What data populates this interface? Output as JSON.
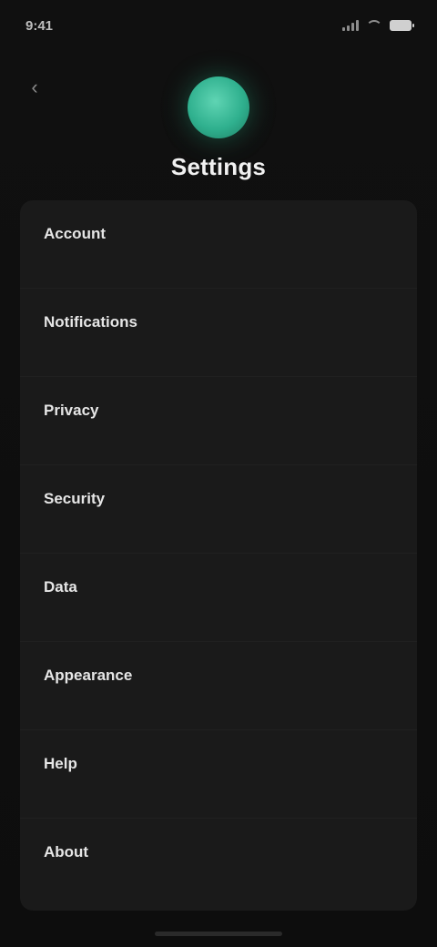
{
  "status_bar": {
    "time": "9:41"
  },
  "nav": {
    "back_glyph": "‹"
  },
  "header": {
    "title": "Settings"
  },
  "settings": [
    {
      "title": "Account",
      "subtitle": ""
    },
    {
      "title": "Notifications",
      "subtitle": ""
    },
    {
      "title": "Privacy",
      "subtitle": ""
    },
    {
      "title": "Security",
      "subtitle": ""
    },
    {
      "title": "Data",
      "subtitle": ""
    },
    {
      "title": "Appearance",
      "subtitle": ""
    },
    {
      "title": "Help",
      "subtitle": ""
    },
    {
      "title": "About",
      "subtitle": ""
    }
  ],
  "colors": {
    "accent": "#2fb08e",
    "background": "#0d0d0d",
    "card": "#1a1a1a"
  }
}
